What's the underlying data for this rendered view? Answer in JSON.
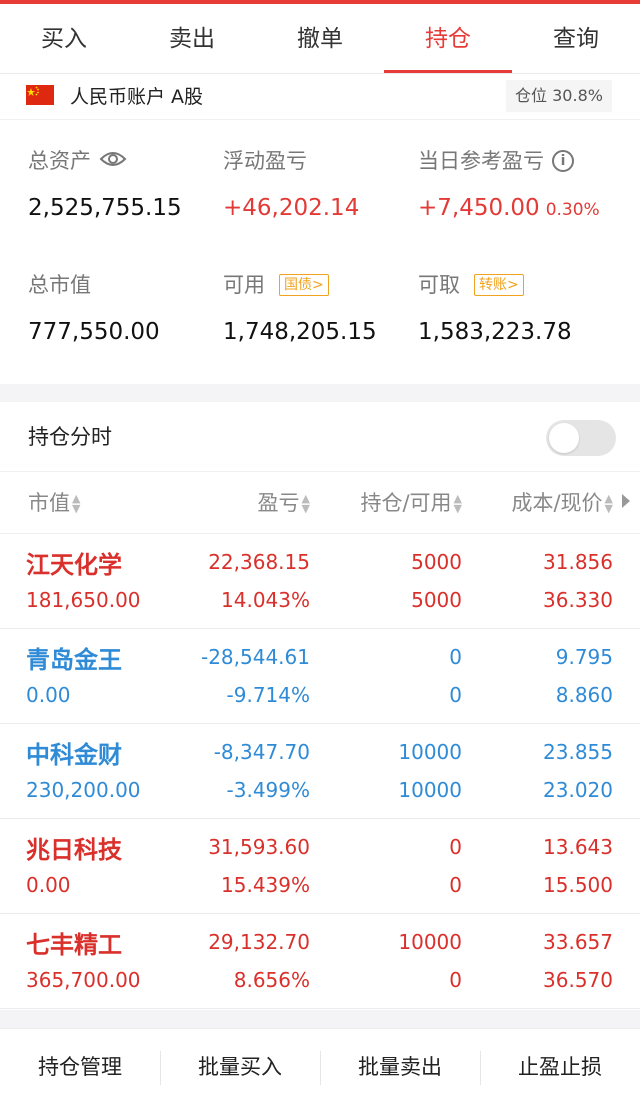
{
  "tabs": [
    {
      "label": "买入"
    },
    {
      "label": "卖出"
    },
    {
      "label": "撤单"
    },
    {
      "label": "持仓",
      "active": true
    },
    {
      "label": "查询"
    }
  ],
  "account": {
    "label": "人民币账户 A股",
    "position_badge": "仓位 30.8%"
  },
  "summary": {
    "total_assets_label": "总资产",
    "total_assets": "2,525,755.15",
    "floating_pl_label": "浮动盈亏",
    "floating_pl": "+46,202.14",
    "daily_pl_label": "当日参考盈亏",
    "daily_pl": "+7,450.00",
    "daily_pl_pct": "0.30%",
    "market_value_label": "总市值",
    "market_value": "777,550.00",
    "available_label": "可用",
    "available_chip": "国债>",
    "available": "1,748,205.15",
    "withdrawable_label": "可取",
    "withdrawable_chip": "转账>",
    "withdrawable": "1,583,223.78"
  },
  "holding_timeshare": {
    "label": "持仓分时",
    "enabled": false
  },
  "table": {
    "headers": {
      "market_value": "市值",
      "pl": "盈亏",
      "holding": "持仓/可用",
      "cost": "成本/现价"
    },
    "rows": [
      {
        "name": "江天化学",
        "market_value": "181,650.00",
        "pl": "22,368.15",
        "pl_pct": "14.043%",
        "holding": "5000",
        "available": "5000",
        "cost": "31.856",
        "price": "36.330",
        "color": "red"
      },
      {
        "name": "青岛金王",
        "market_value": "0.00",
        "pl": "-28,544.61",
        "pl_pct": "-9.714%",
        "holding": "0",
        "available": "0",
        "cost": "9.795",
        "price": "8.860",
        "color": "blue"
      },
      {
        "name": "中科金财",
        "market_value": "230,200.00",
        "pl": "-8,347.70",
        "pl_pct": "-3.499%",
        "holding": "10000",
        "available": "10000",
        "cost": "23.855",
        "price": "23.020",
        "color": "blue"
      },
      {
        "name": "兆日科技",
        "market_value": "0.00",
        "pl": "31,593.60",
        "pl_pct": "15.439%",
        "holding": "0",
        "available": "0",
        "cost": "13.643",
        "price": "15.500",
        "color": "red"
      },
      {
        "name": "七丰精工",
        "market_value": "365,700.00",
        "pl": "29,132.70",
        "pl_pct": "8.656%",
        "holding": "10000",
        "available": "0",
        "cost": "33.657",
        "price": "36.570",
        "color": "red"
      }
    ]
  },
  "bottom_bar": [
    {
      "label": "持仓管理"
    },
    {
      "label": "批量买入"
    },
    {
      "label": "批量卖出"
    },
    {
      "label": "止盈止损"
    }
  ],
  "colors": {
    "accent": "#e63b36",
    "gain": "#d9302b",
    "loss": "#2f8bd6",
    "chip": "#f0a31e"
  }
}
